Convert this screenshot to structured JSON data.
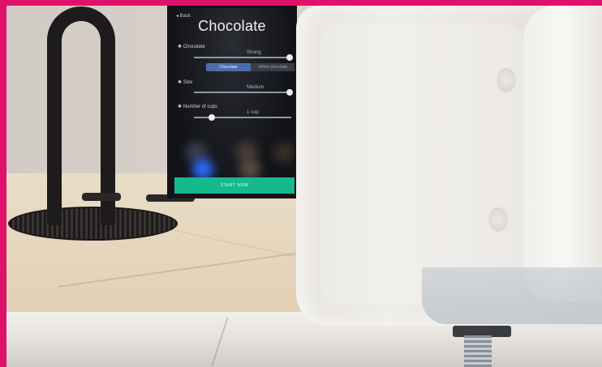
{
  "tablet": {
    "back_label": "◂ Back",
    "title": "Chocolate",
    "sections": [
      {
        "label": "✱ Chocolate",
        "value": "Strong"
      },
      {
        "label": "✱ Size",
        "value": "Medium"
      },
      {
        "label": "✱ Number of cups",
        "value": "1 cup"
      }
    ],
    "segment": {
      "left": "Chocolate",
      "right": "White chocolate",
      "selected": "left"
    },
    "start_button": "START NOW"
  },
  "colors": {
    "frame_border": "#e0116a",
    "start_button": "#15b98c"
  }
}
